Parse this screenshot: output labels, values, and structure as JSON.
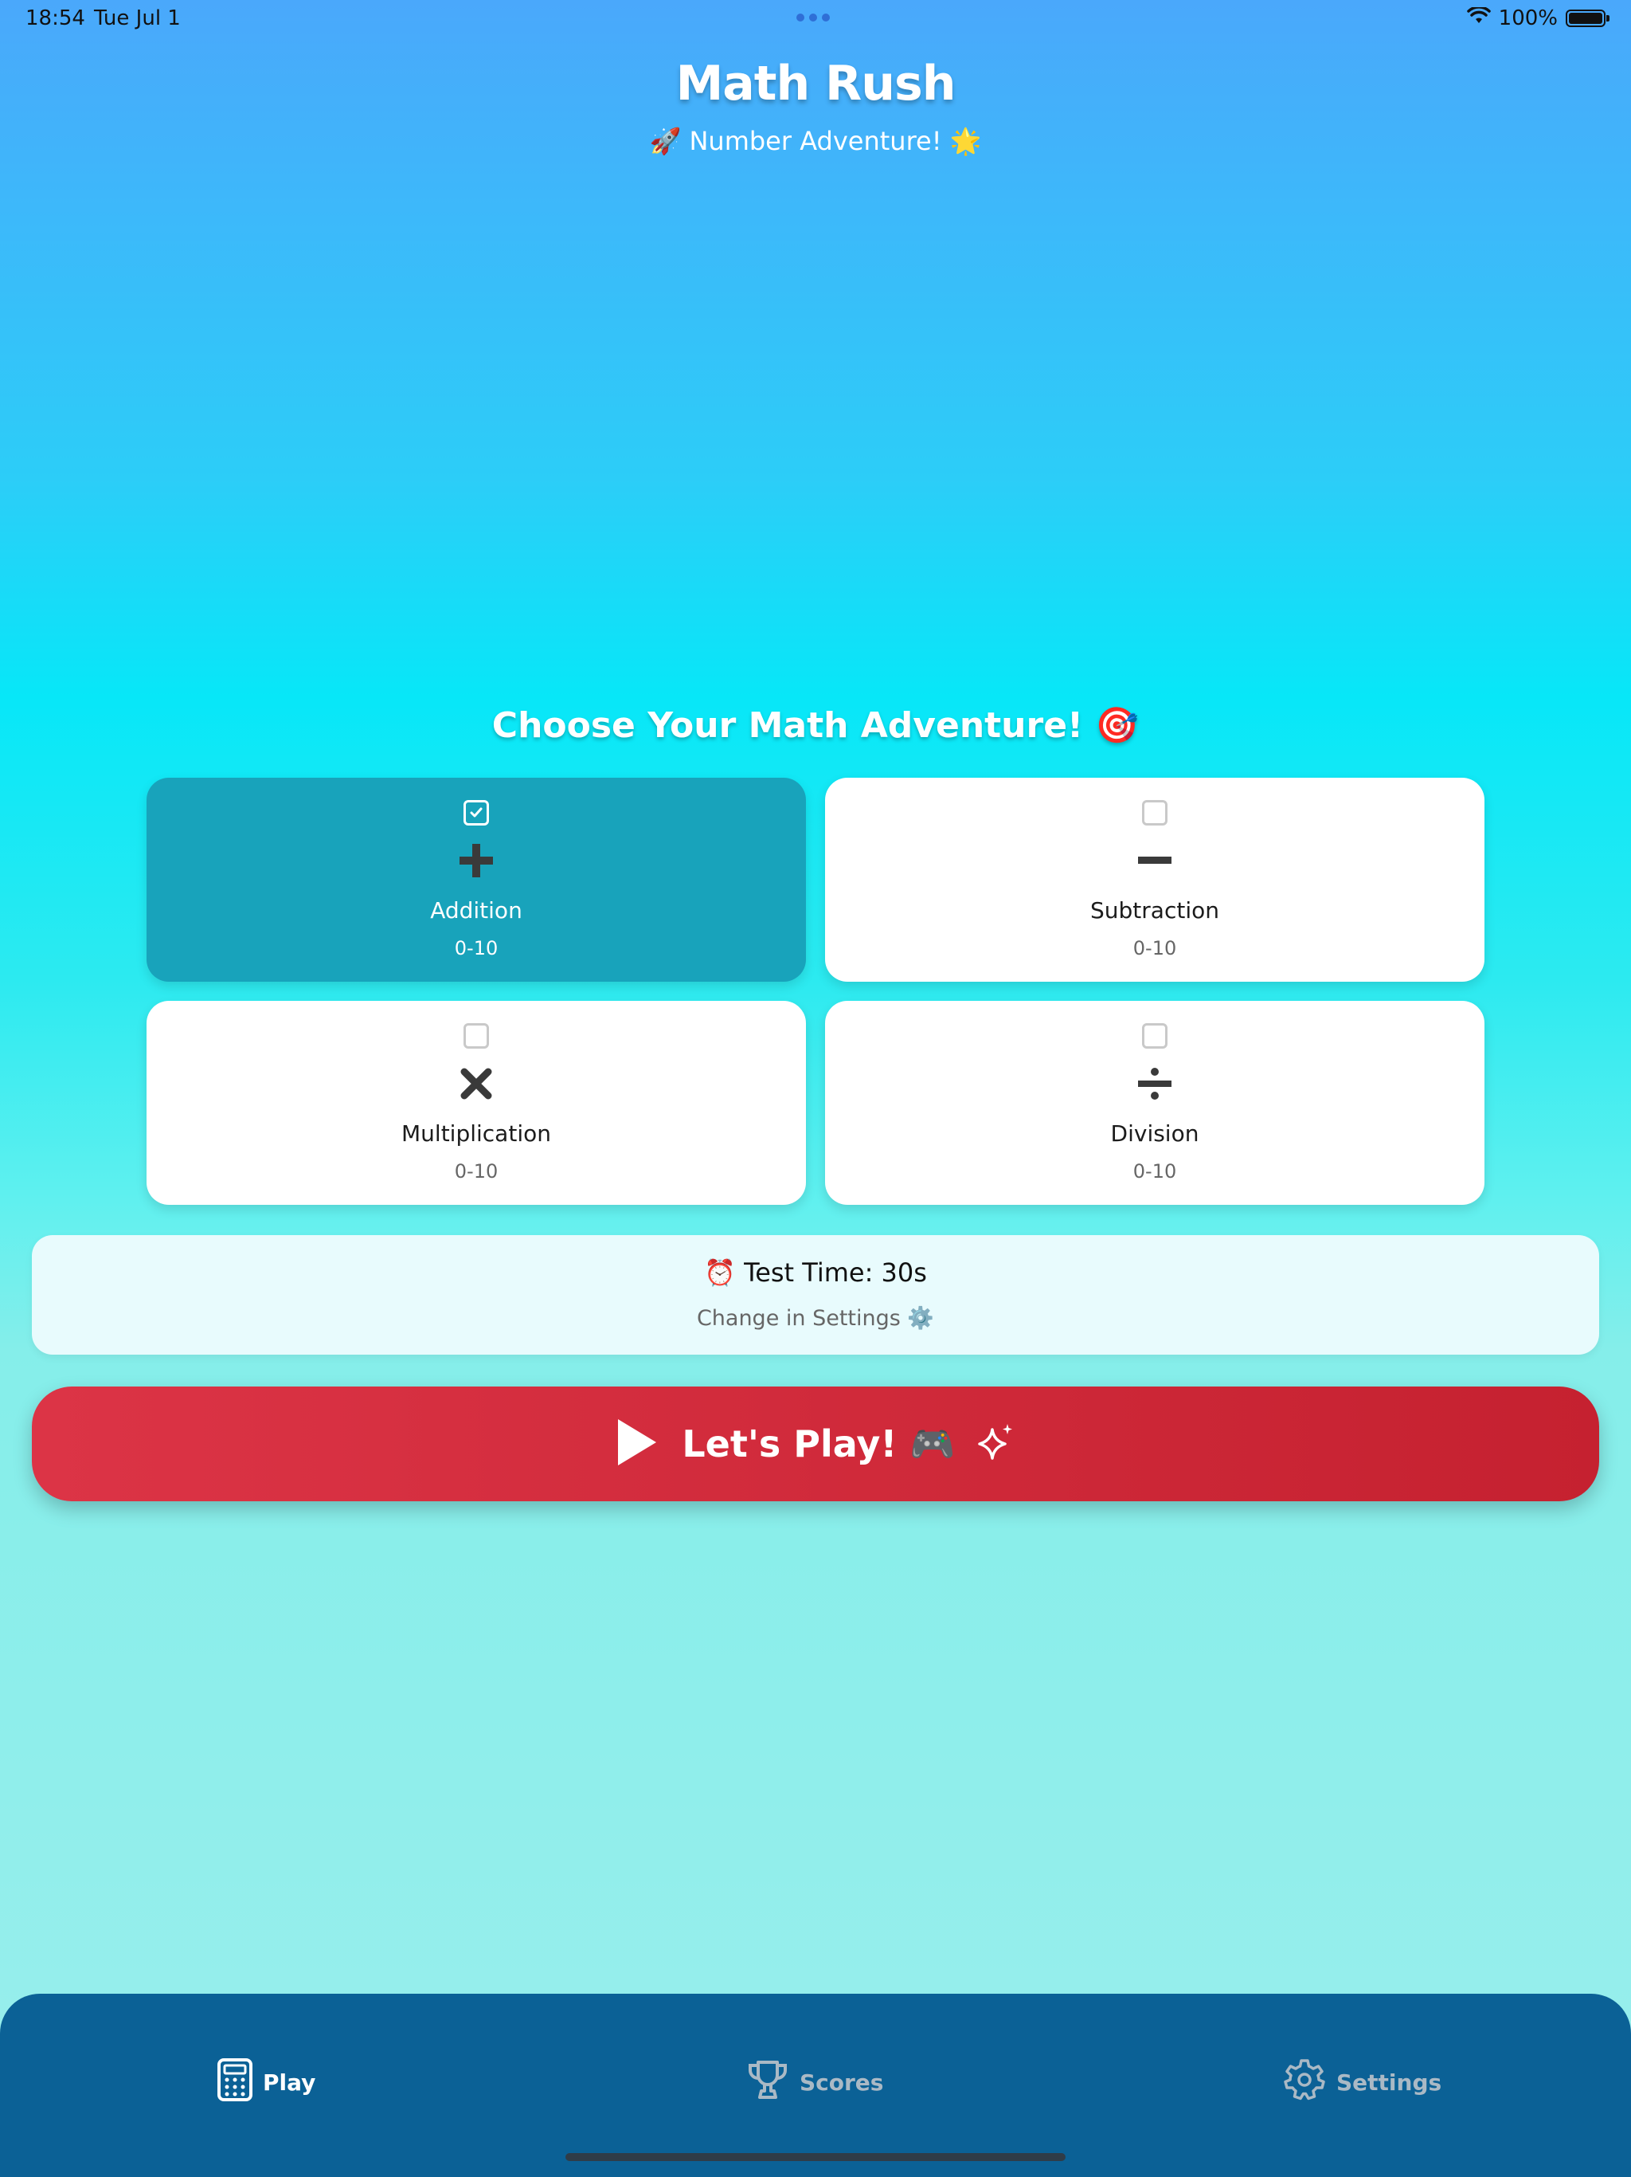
{
  "status_bar": {
    "time": "18:54",
    "date": "Tue Jul 1",
    "battery": "100%"
  },
  "header": {
    "title": "Math Rush",
    "subtitle": "🚀 Number Adventure! 🌟"
  },
  "section": {
    "title": "Choose Your Math Adventure! 🎯"
  },
  "operations": [
    {
      "name": "Addition",
      "range": "0-10",
      "selected": true,
      "icon": "plus-icon"
    },
    {
      "name": "Subtraction",
      "range": "0-10",
      "selected": false,
      "icon": "minus-icon"
    },
    {
      "name": "Multiplication",
      "range": "0-10",
      "selected": false,
      "icon": "times-icon"
    },
    {
      "name": "Division",
      "range": "0-10",
      "selected": false,
      "icon": "divide-icon"
    }
  ],
  "test_time": {
    "label": "⏰ Test Time: 30s",
    "hint": "Change in Settings ⚙️"
  },
  "play_button": {
    "label": "Let's Play! 🎮"
  },
  "tabs": [
    {
      "label": "Play",
      "icon": "calculator-icon",
      "active": true
    },
    {
      "label": "Scores",
      "icon": "trophy-icon",
      "active": false
    },
    {
      "label": "Settings",
      "icon": "gear-icon",
      "active": false
    }
  ],
  "colors": {
    "selected_card": "#18a3bb",
    "play_button": "#d62d3e",
    "tab_bar": "#0b6196"
  }
}
